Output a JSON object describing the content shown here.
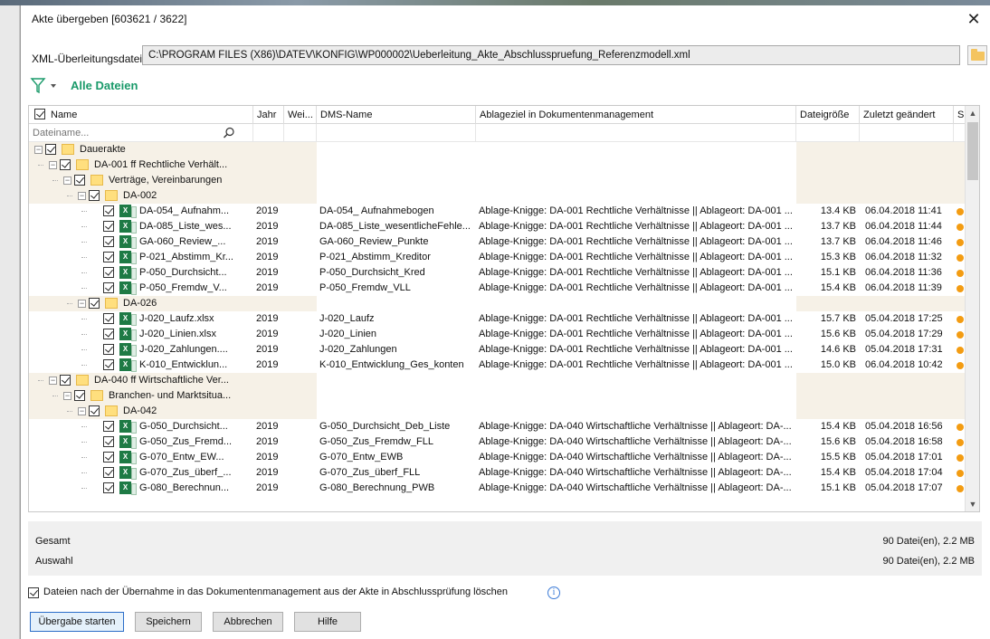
{
  "dialog": {
    "title": "Akte übergeben [603621 / 3622]",
    "close_glyph": "✕",
    "xml_label": "XML-Überleitungsdatei",
    "xml_value": "C:\\PROGRAM FILES (X86)\\DATEV\\KONFIG\\WP000002\\Ueberleitung_Akte_Abschlusspruefung_Referenzmodell.xml",
    "filter_label": "Alle Dateien"
  },
  "table": {
    "columns": {
      "name": "Name",
      "jahr": "Jahr",
      "wei": "Wei...",
      "dms": "DMS-Name",
      "ablage": "Ablageziel in Dokumentenmanagement",
      "size": "Dateigröße",
      "date": "Zuletzt geändert",
      "s": "S."
    },
    "filter_placeholder": "Dateiname...",
    "rows": [
      {
        "type": "folder",
        "level": 0,
        "name": "Dauerakte"
      },
      {
        "type": "folder",
        "level": 1,
        "name": "DA-001 ff  Rechtliche Verhält..."
      },
      {
        "type": "folder",
        "level": 2,
        "name": "Verträge, Vereinbarungen"
      },
      {
        "type": "folder",
        "level": 3,
        "name": "DA-002"
      },
      {
        "type": "file",
        "level": 4,
        "name": "DA-054_ Aufnahm...",
        "jahr": "2019",
        "dms": "DA-054_ Aufnahmebogen",
        "ablage": "Ablage-Knigge: DA-001 Rechtliche Verhältnisse || Ablageort: DA-001 ...",
        "size": "13.4 KB",
        "date": "06.04.2018 11:41"
      },
      {
        "type": "file",
        "level": 4,
        "name": "DA-085_Liste_wes...",
        "jahr": "2019",
        "dms": "DA-085_Liste_wesentlicheFehle...",
        "ablage": "Ablage-Knigge: DA-001 Rechtliche Verhältnisse || Ablageort: DA-001 ...",
        "size": "13.7 KB",
        "date": "06.04.2018 11:44"
      },
      {
        "type": "file",
        "level": 4,
        "name": "GA-060_Review_...",
        "jahr": "2019",
        "dms": "GA-060_Review_Punkte",
        "ablage": "Ablage-Knigge: DA-001 Rechtliche Verhältnisse || Ablageort: DA-001 ...",
        "size": "13.7 KB",
        "date": "06.04.2018 11:46"
      },
      {
        "type": "file",
        "level": 4,
        "name": "P-021_Abstimm_Kr...",
        "jahr": "2019",
        "dms": "P-021_Abstimm_Kreditor",
        "ablage": "Ablage-Knigge: DA-001 Rechtliche Verhältnisse || Ablageort: DA-001 ...",
        "size": "15.3 KB",
        "date": "06.04.2018 11:32"
      },
      {
        "type": "file",
        "level": 4,
        "name": "P-050_Durchsicht...",
        "jahr": "2019",
        "dms": "P-050_Durchsicht_Kred",
        "ablage": "Ablage-Knigge: DA-001 Rechtliche Verhältnisse || Ablageort: DA-001 ...",
        "size": "15.1 KB",
        "date": "06.04.2018 11:36"
      },
      {
        "type": "file",
        "level": 4,
        "name": "P-050_Fremdw_V...",
        "jahr": "2019",
        "dms": "P-050_Fremdw_VLL",
        "ablage": "Ablage-Knigge: DA-001 Rechtliche Verhältnisse || Ablageort: DA-001 ...",
        "size": "15.4 KB",
        "date": "06.04.2018 11:39"
      },
      {
        "type": "folder",
        "level": 3,
        "name": "DA-026"
      },
      {
        "type": "file",
        "level": 4,
        "name": "J-020_Laufz.xlsx",
        "jahr": "2019",
        "dms": "J-020_Laufz",
        "ablage": "Ablage-Knigge: DA-001 Rechtliche Verhältnisse || Ablageort: DA-001 ...",
        "size": "15.7 KB",
        "date": "05.04.2018 17:25"
      },
      {
        "type": "file",
        "level": 4,
        "name": "J-020_Linien.xlsx",
        "jahr": "2019",
        "dms": "J-020_Linien",
        "ablage": "Ablage-Knigge: DA-001 Rechtliche Verhältnisse || Ablageort: DA-001 ...",
        "size": "15.6 KB",
        "date": "05.04.2018 17:29"
      },
      {
        "type": "file",
        "level": 4,
        "name": "J-020_Zahlungen....",
        "jahr": "2019",
        "dms": "J-020_Zahlungen",
        "ablage": "Ablage-Knigge: DA-001 Rechtliche Verhältnisse || Ablageort: DA-001 ...",
        "size": "14.6 KB",
        "date": "05.04.2018 17:31"
      },
      {
        "type": "file",
        "level": 4,
        "name": "K-010_Entwicklun...",
        "jahr": "2019",
        "dms": "K-010_Entwicklung_Ges_konten",
        "ablage": "Ablage-Knigge: DA-001 Rechtliche Verhältnisse || Ablageort: DA-001 ...",
        "size": "15.0 KB",
        "date": "06.04.2018 10:42"
      },
      {
        "type": "folder",
        "level": 1,
        "name": "DA-040 ff  Wirtschaftliche Ver..."
      },
      {
        "type": "folder",
        "level": 2,
        "name": "Branchen- und Marktsitua..."
      },
      {
        "type": "folder",
        "level": 3,
        "name": "DA-042"
      },
      {
        "type": "file",
        "level": 4,
        "name": "G-050_Durchsicht...",
        "jahr": "2019",
        "dms": "G-050_Durchsicht_Deb_Liste",
        "ablage": "Ablage-Knigge: DA-040 Wirtschaftliche Verhältnisse || Ablageort: DA-...",
        "size": "15.4 KB",
        "date": "05.04.2018 16:56"
      },
      {
        "type": "file",
        "level": 4,
        "name": "G-050_Zus_Fremd...",
        "jahr": "2019",
        "dms": "G-050_Zus_Fremdw_FLL",
        "ablage": "Ablage-Knigge: DA-040 Wirtschaftliche Verhältnisse || Ablageort: DA-...",
        "size": "15.6 KB",
        "date": "05.04.2018 16:58"
      },
      {
        "type": "file",
        "level": 4,
        "name": "G-070_Entw_EW...",
        "jahr": "2019",
        "dms": "G-070_Entw_EWB",
        "ablage": "Ablage-Knigge: DA-040 Wirtschaftliche Verhältnisse || Ablageort: DA-...",
        "size": "15.5 KB",
        "date": "05.04.2018 17:01"
      },
      {
        "type": "file",
        "level": 4,
        "name": "G-070_Zus_überf_...",
        "jahr": "2019",
        "dms": "G-070_Zus_überf_FLL",
        "ablage": "Ablage-Knigge: DA-040 Wirtschaftliche Verhältnisse || Ablageort: DA-...",
        "size": "15.4 KB",
        "date": "05.04.2018 17:04"
      },
      {
        "type": "file",
        "level": 4,
        "name": "G-080_Berechnun...",
        "jahr": "2019",
        "dms": "G-080_Berechnung_PWB",
        "ablage": "Ablage-Knigge: DA-040 Wirtschaftliche Verhältnisse || Ablageort: DA-...",
        "size": "15.1 KB",
        "date": "05.04.2018 17:07"
      }
    ]
  },
  "summary": {
    "gesamt_label": "Gesamt",
    "gesamt_value": "90 Datei(en), 2.2 MB",
    "auswahl_label": "Auswahl",
    "auswahl_value": "90 Datei(en), 2.2 MB"
  },
  "options": {
    "delete_label": "Dateien nach der Übernahme in das Dokumentenmanagement aus der Akte in Abschlussprüfung löschen",
    "info_glyph": "i"
  },
  "buttons": {
    "start": "Übergabe starten",
    "save": "Speichern",
    "cancel": "Abbrechen",
    "help": "Hilfe"
  },
  "icons": {
    "filter": "filter-funnel-icon",
    "folder": "folder-icon",
    "excel": "excel-file-icon",
    "status": "status-dot-icon",
    "search": "search-icon"
  },
  "colors": {
    "accent_green": "#1a9a6a",
    "status_orange": "#f39c12",
    "folder_yellow": "#ffdf7e"
  }
}
